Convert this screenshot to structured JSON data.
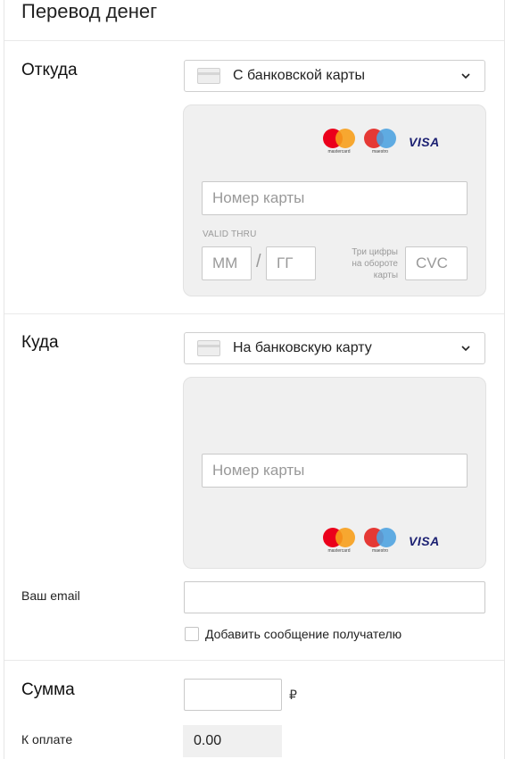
{
  "title": "Перевод денег",
  "from": {
    "label": "Откуда",
    "select_value": "С банковской карты",
    "card_number_placeholder": "Номер карты",
    "valid_thru_label": "VALID THRU",
    "month_placeholder": "ММ",
    "year_placeholder": "ГГ",
    "slash": "/",
    "cvc_hint_lines": [
      "Три цифры",
      "на обороте",
      "карты"
    ],
    "cvc_placeholder": "CVC"
  },
  "to": {
    "label": "Куда",
    "select_value": "На банковскую карту",
    "card_number_placeholder": "Номер карты"
  },
  "logos": {
    "mastercard_caption": "mastercard",
    "maestro_caption": "maestro",
    "visa": "VISA"
  },
  "email": {
    "label": "Ваш email",
    "value": ""
  },
  "message_checkbox": {
    "label": "Добавить сообщение получателю",
    "checked": false
  },
  "amount": {
    "label": "Сумма",
    "value": "",
    "currency": "₽"
  },
  "to_pay": {
    "label": "К оплате",
    "value": "0.00"
  },
  "colors": {
    "mc_red": "#eb001b",
    "mc_orange": "#f79e1b",
    "maestro_red": "#e53935",
    "maestro_blue": "#4fa3e0",
    "visa_blue": "#1a1f71"
  }
}
